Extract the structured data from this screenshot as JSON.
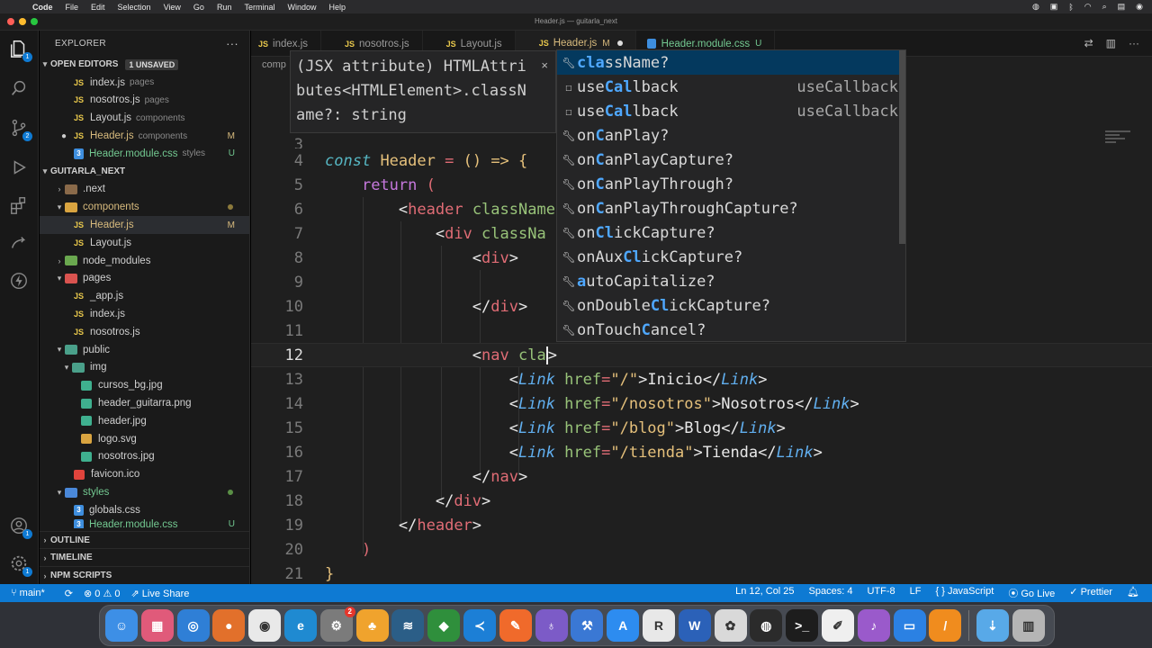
{
  "menubar": {
    "app": "Code",
    "items": [
      "File",
      "Edit",
      "Selection",
      "View",
      "Go",
      "Run",
      "Terminal",
      "Window",
      "Help"
    ]
  },
  "window": {
    "title": "Header.js — guitarla_next"
  },
  "sidebar": {
    "title": "EXPLORER",
    "open_editors": {
      "label": "OPEN EDITORS",
      "badge": "1 UNSAVED",
      "files": [
        {
          "name": "index.js",
          "dir": "pages",
          "flag": ""
        },
        {
          "name": "nosotros.js",
          "dir": "pages",
          "flag": ""
        },
        {
          "name": "Layout.js",
          "dir": "components",
          "flag": ""
        },
        {
          "name": "Header.js",
          "dir": "components",
          "flag": "M"
        },
        {
          "name": "Header.module.css",
          "dir": "styles",
          "flag": "U"
        }
      ]
    },
    "project": {
      "label": "GUITARLA_NEXT",
      "tree": [
        {
          "name": ".next",
          "flag": ""
        },
        {
          "name": "components",
          "flag": ""
        },
        {
          "name": "Header.js",
          "flag": "M"
        },
        {
          "name": "Layout.js",
          "flag": ""
        },
        {
          "name": "node_modules",
          "flag": ""
        },
        {
          "name": "pages",
          "flag": ""
        },
        {
          "name": "_app.js",
          "flag": ""
        },
        {
          "name": "index.js",
          "flag": ""
        },
        {
          "name": "nosotros.js",
          "flag": ""
        },
        {
          "name": "public",
          "flag": ""
        },
        {
          "name": "img",
          "flag": ""
        },
        {
          "name": "cursos_bg.jpg",
          "flag": ""
        },
        {
          "name": "header_guitarra.png",
          "flag": ""
        },
        {
          "name": "header.jpg",
          "flag": ""
        },
        {
          "name": "logo.svg",
          "flag": ""
        },
        {
          "name": "nosotros.jpg",
          "flag": ""
        },
        {
          "name": "favicon.ico",
          "flag": ""
        },
        {
          "name": "styles",
          "flag": ""
        },
        {
          "name": "globals.css",
          "flag": ""
        },
        {
          "name": "Header.module.css",
          "flag": "U"
        }
      ]
    },
    "sections": [
      "OUTLINE",
      "TIMELINE",
      "NPM SCRIPTS"
    ]
  },
  "tabs": [
    {
      "name": "index.js",
      "flag": ""
    },
    {
      "name": "nosotros.js",
      "flag": ""
    },
    {
      "name": "Layout.js",
      "flag": ""
    },
    {
      "name": "Header.js",
      "flag": "M"
    },
    {
      "name": "Header.module.css",
      "flag": "U"
    }
  ],
  "editor": {
    "breadcrumb": "comp",
    "line_numbers": [
      "4",
      "5",
      "6",
      "7",
      "8",
      "9",
      "10",
      "11",
      "12",
      "13",
      "14",
      "15",
      "16",
      "17",
      "18",
      "19",
      "20",
      "21"
    ],
    "partial_line": "3",
    "tokens": {
      "const": "const",
      "Header": "Header",
      "eq": "=",
      "arrow_fn": "() =>",
      "brace": "{",
      "return": "return",
      "paren_open": "(",
      "header": "header",
      "classNam": "className",
      "div": "div",
      "classNa": "classNa",
      "nav": "nav",
      "cla": "cla",
      "Link": "Link",
      "href": "href",
      "href1": "\"/\"",
      "text1": "Inicio",
      "href2": "\"/nosotros\"",
      "text2": "Nosotros",
      "href3": "\"/blog\"",
      "text3": "Blog",
      "href4": "\"/tienda\"",
      "text4": "Tienda",
      "paren_close": ")",
      "brace_close": "}"
    }
  },
  "hover": {
    "lines": [
      "(JSX attribute) HTMLAttri",
      "butes<HTMLElement>.classN",
      "ame?: string"
    ]
  },
  "suggest": {
    "items": [
      {
        "icon": "wrench-icon",
        "pre": "",
        "m1": "cla",
        "post": "ssName?",
        "detail": ""
      },
      {
        "icon": "square-icon",
        "pre": "use",
        "m1": "Cal",
        "post": "lback",
        "detail": "useCallback"
      },
      {
        "icon": "square-icon",
        "pre": "use",
        "m1": "Cal",
        "post": "lback",
        "detail": "useCallback"
      },
      {
        "icon": "wrench-icon",
        "pre": "on",
        "m1": "C",
        "post": "anPlay?",
        "detail": ""
      },
      {
        "icon": "wrench-icon",
        "pre": "on",
        "m1": "C",
        "post": "anPlayCapture?",
        "detail": ""
      },
      {
        "icon": "wrench-icon",
        "pre": "on",
        "m1": "C",
        "post": "anPlayThrough?",
        "detail": ""
      },
      {
        "icon": "wrench-icon",
        "pre": "on",
        "m1": "C",
        "post": "anPlayThroughCapture?",
        "detail": ""
      },
      {
        "icon": "wrench-icon",
        "pre": "on",
        "m1": "Cl",
        "post": "ickCapture?",
        "detail": ""
      },
      {
        "icon": "wrench-icon",
        "pre": "onAux",
        "m1": "Cl",
        "post": "ickCapture?",
        "detail": ""
      },
      {
        "icon": "wrench-icon",
        "pre": "",
        "m1": "a",
        "post": "utoCapitalize?",
        "detail": ""
      },
      {
        "icon": "wrench-icon",
        "pre": "onDouble",
        "m1": "Cl",
        "post": "ickCapture?",
        "detail": ""
      },
      {
        "icon": "wrench-icon",
        "pre": "onTouch",
        "m1": "C",
        "post": "ancel?",
        "detail": ""
      }
    ]
  },
  "statusbar": {
    "branch": "main*",
    "problems": "⊗ 0 ⚠ 0",
    "liveshare": "Live Share",
    "position": "Ln 12, Col 25",
    "spaces": "Spaces: 4",
    "encoding": "UTF-8",
    "eol": "LF",
    "language": "{ } JavaScript",
    "golive": "Go Live",
    "prettier": "✓ Prettier"
  },
  "activity": {
    "explorer_badge": "1",
    "scm_badge": "2"
  },
  "dock": {
    "apps": [
      {
        "name": "finder",
        "color": "#3d8fe6",
        "glyph": "☺"
      },
      {
        "name": "launchpad",
        "color": "#e05a7a",
        "glyph": "▦"
      },
      {
        "name": "safari",
        "color": "#2f7fd6",
        "glyph": "◎"
      },
      {
        "name": "firefox",
        "color": "#e2702b",
        "glyph": "●"
      },
      {
        "name": "chrome",
        "color": "#e9e9e9",
        "glyph": "◉"
      },
      {
        "name": "edge",
        "color": "#1f8ad1",
        "glyph": "e"
      },
      {
        "name": "system-preferences",
        "color": "#7b7b7b",
        "glyph": "⚙",
        "badge": "2"
      },
      {
        "name": "elephant",
        "color": "#f0a32d",
        "glyph": "♣"
      },
      {
        "name": "workbench",
        "color": "#2b5e87",
        "glyph": "≋"
      },
      {
        "name": "mongodb",
        "color": "#2f8f3c",
        "glyph": "◆"
      },
      {
        "name": "vscode",
        "color": "#1c7fd6",
        "glyph": "≺"
      },
      {
        "name": "postman",
        "color": "#f06a2b",
        "glyph": "✎"
      },
      {
        "name": "github",
        "color": "#7c5bc7",
        "glyph": "♁"
      },
      {
        "name": "xcode",
        "color": "#3a78d4",
        "glyph": "⚒"
      },
      {
        "name": "app-store",
        "color": "#2d8cf0",
        "glyph": "A"
      },
      {
        "name": "ruler",
        "color": "#e8e8e8",
        "glyph": "R"
      },
      {
        "name": "word",
        "color": "#2b61b8",
        "glyph": "W"
      },
      {
        "name": "photos",
        "color": "#d9d9d9",
        "glyph": "✿"
      },
      {
        "name": "obs",
        "color": "#2b2b2b",
        "glyph": "◍"
      },
      {
        "name": "terminal",
        "color": "#1d1d1d",
        "glyph": ">_"
      },
      {
        "name": "textedit",
        "color": "#efefef",
        "glyph": "✐"
      },
      {
        "name": "audio",
        "color": "#9a5acb",
        "glyph": "♪"
      },
      {
        "name": "keynote",
        "color": "#2b81e3",
        "glyph": "▭"
      },
      {
        "name": "pencil",
        "color": "#f08c1e",
        "glyph": "/"
      },
      {
        "name": "downloads",
        "color": "#58a9e8",
        "glyph": "⇣"
      },
      {
        "name": "trash",
        "color": "#b5b5b5",
        "glyph": "▥"
      }
    ]
  }
}
